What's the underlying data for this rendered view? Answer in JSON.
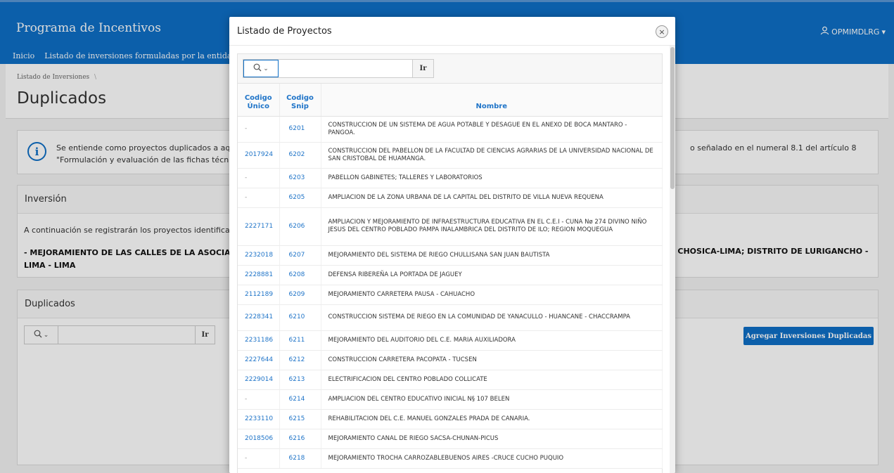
{
  "app": {
    "title": "Programa de Incentivos",
    "user": "OPMIMDLRG",
    "nav": [
      "Inicio",
      "Listado de inversiones formuladas por la entida"
    ]
  },
  "page": {
    "breadcrumb": "Listado de Inversiones",
    "breadcrumb_sep": "\\",
    "title": "Duplicados"
  },
  "info": {
    "icon": "i",
    "text_left": "Se entiende como proyectos duplicados a aqu",
    "text_left2": "\"Formulación y evaluación de las fichas técnic",
    "text_right": "o señalado en el numeral 8.1 del artículo 8"
  },
  "inversion": {
    "heading": "Inversión",
    "intro": "A continuación se registrarán los proyectos identifica",
    "bold_left": "- MEJORAMIENTO DE LAS CALLES DE LA ASOCIAC",
    "bold_left2": "LIMA - LIMA",
    "bold_right": "- CHOSICA-LIMA; DISTRITO DE LURIGANCHO -"
  },
  "duplicados": {
    "heading": "Duplicados",
    "go_label": "Ir",
    "add_button": "Agregar Inversiones Duplicadas"
  },
  "modal": {
    "title": "Listado de Proyectos",
    "close": "×",
    "go_label": "Ir",
    "columns": {
      "codigo_unico": "Codigo Único",
      "codigo_snip": "Codigo Snip",
      "nombre": "Nombre"
    },
    "rows": [
      {
        "unico": "-",
        "snip": "6201",
        "nombre": "CONSTRUCCION DE UN SISTEMA DE AGUA POTABLE Y DESAGUE EN EL ANEXO DE BOCA MANTARO - PANGOA.",
        "h": "h2"
      },
      {
        "unico": "2017924",
        "snip": "6202",
        "nombre": "CONSTRUCCION DEL PABELLON DE LA FACULTAD DE CIENCIAS AGRARIAS DE LA UNIVERSIDAD NACIONAL DE SAN CRISTOBAL DE HUAMANGA.",
        "h": "h2"
      },
      {
        "unico": "-",
        "snip": "6203",
        "nombre": "PABELLON GABINETES; TALLERES Y LABORATORIOS",
        "h": "h1"
      },
      {
        "unico": "-",
        "snip": "6205",
        "nombre": "AMPLIACION DE LA ZONA URBANA DE LA CAPITAL DEL DISTRITO DE VILLA NUEVA REQUENA",
        "h": "h1"
      },
      {
        "unico": "2227171",
        "snip": "6206",
        "nombre": "AMPLIACION Y MEJORAMIENTO DE INFRAESTRUCTURA EDUCATIVA EN EL C.E.I - CUNA Nø 274 DIVINO NIÑO JESUS DEL CENTRO POBLADO PAMPA INALAMBRICA DEL DISTRITO DE ILO; REGION MOQUEGUA",
        "h": "h3"
      },
      {
        "unico": "2232018",
        "snip": "6207",
        "nombre": "MEJORAMIENTO DEL SISTEMA DE RIEGO CHULLISANA SAN JUAN BAUTISTA",
        "h": "h1"
      },
      {
        "unico": "2228881",
        "snip": "6208",
        "nombre": "DEFENSA RIBEREÑA LA PORTADA DE JAGUEY",
        "h": "h1"
      },
      {
        "unico": "2112189",
        "snip": "6209",
        "nombre": "MEJORAMIENTO CARRETERA PAUSA - CAHUACHO",
        "h": "h1"
      },
      {
        "unico": "2228341",
        "snip": "6210",
        "nombre": "CONSTRUCCION SISTEMA DE RIEGO EN LA COMUNIDAD DE YANACULLO - HUANCANE - CHACCRAMPA",
        "h": "h2"
      },
      {
        "unico": "2231186",
        "snip": "6211",
        "nombre": "MEJORAMIENTO DEL AUDITORIO DEL C.E. MARIA AUXILIADORA",
        "h": "h1"
      },
      {
        "unico": "2227644",
        "snip": "6212",
        "nombre": "CONSTRUCCION CARRETERA PACOPATA - TUCSEN",
        "h": "h1"
      },
      {
        "unico": "2229014",
        "snip": "6213",
        "nombre": "ELECTRIFICACION DEL CENTRO POBLADO COLLICATE",
        "h": "h1"
      },
      {
        "unico": "-",
        "snip": "6214",
        "nombre": "AMPLIACION DEL CENTRO EDUCATIVO INICIAL N§ 107 BELEN",
        "h": "h1"
      },
      {
        "unico": "2233110",
        "snip": "6215",
        "nombre": "REHABILITACION DEL C.E. MANUEL GONZALES PRADA DE CANARIA.",
        "h": "h1"
      },
      {
        "unico": "2018506",
        "snip": "6216",
        "nombre": "MEJORAMIENTO CANAL DE RIEGO SACSA-CHUNAN-PICUS",
        "h": "h1"
      },
      {
        "unico": "-",
        "snip": "6218",
        "nombre": "MEJORAMIENTO TROCHA CARROZABLEBUENOS AIRES -CRUCE CUCHO PUQUIO",
        "h": "h1"
      }
    ]
  },
  "icons": {
    "user": "user-icon",
    "search": "search-icon",
    "close": "close-icon",
    "info": "info-icon"
  },
  "colors": {
    "brand": "#0f6fc6",
    "link": "#1f74c8"
  }
}
